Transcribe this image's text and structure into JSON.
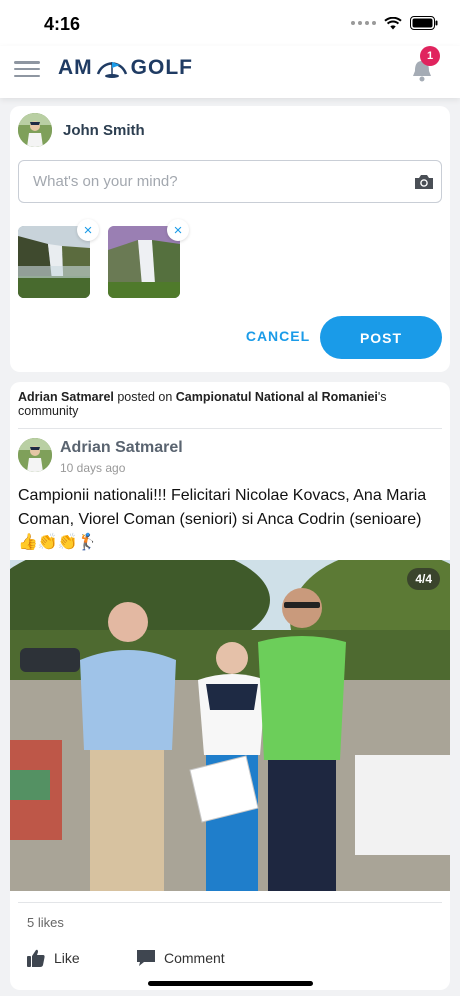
{
  "status_bar": {
    "time": "4:16"
  },
  "header": {
    "logo_left": "AM",
    "logo_right": "GOLF",
    "notification_count": "1"
  },
  "composer": {
    "user_name": "John Smith",
    "placeholder": "What's on your mind?",
    "cancel_label": "CANCEL",
    "post_label": "POST",
    "remove_symbol": "×"
  },
  "post": {
    "author": "Adrian Satmarel",
    "posted_on_text": "posted on",
    "community": "Campionatul National al Romaniei",
    "community_suffix": "'s community",
    "time_ago": "10 days ago",
    "text": "Campionii nationali!!! Felicitari Nicolae Kovacs, Ana Maria Coman, Viorel Coman (seniori) si Anca Codrin (senioare) 👍👏👏🏌️",
    "image_counter": "4/4",
    "likes": "5 likes",
    "like_label": "Like",
    "comment_label": "Comment"
  },
  "colors": {
    "accent": "#1a9be8",
    "badge": "#e0245e",
    "logo": "#1f3b63"
  }
}
